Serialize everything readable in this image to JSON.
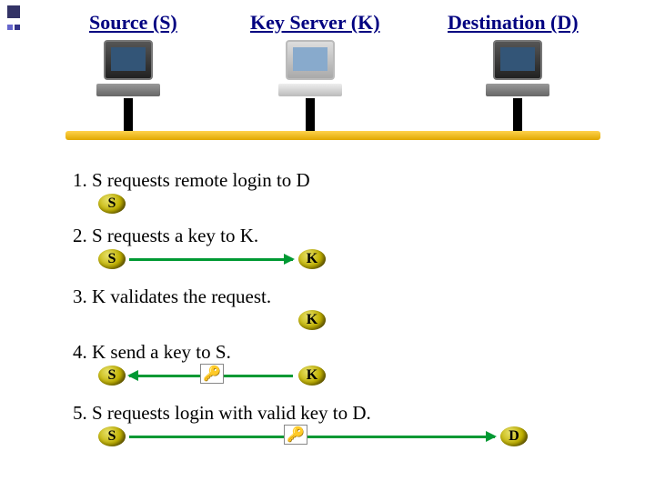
{
  "header": {
    "source": "Source (S)",
    "keyserver": "Key Server (K)",
    "destination": "Destination (D)"
  },
  "nodes": {
    "S": "S",
    "K": "K",
    "D": "D"
  },
  "key_glyph": "🔑",
  "steps": {
    "s1": "1. S requests remote login to D",
    "s2": "2. S requests a key to K.",
    "s3": "3. K validates the request.",
    "s4": "4. K send a key to S.",
    "s5": "5. S requests login with valid key to D."
  }
}
